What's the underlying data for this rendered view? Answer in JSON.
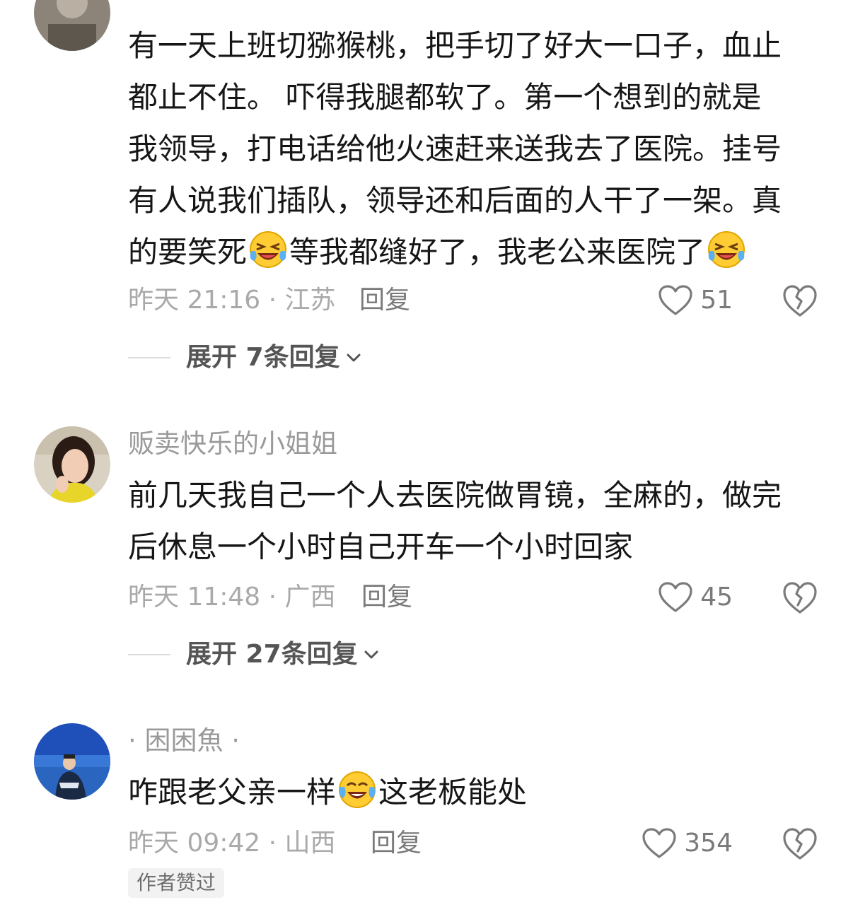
{
  "comments": [
    {
      "lines": [
        "有一天上班切猕猴桃，把手切了好大一口子，血止",
        "都止不住。 吓得我腿都软了。第一个想到的就是",
        "我领导，打电话给他火速赶来送我去了医院。挂号",
        "有人说我们插队，领导还和后面的人干了一架。真"
      ],
      "last_line_parts": [
        "的要笑死",
        "等我都缝好了，我老公来医院了",
        ""
      ],
      "emoji": "grinning-squinting-tears-emoji",
      "meta": "昨天 21:16 · 江苏",
      "reply": "回复",
      "likes": "51",
      "expand": "展开 7条回复"
    },
    {
      "username": "贩卖快乐的小姐姐",
      "lines": [
        "前几天我自己一个人去医院做胃镜，全麻的，做完",
        "后休息一个小时自己开车一个小时回家"
      ],
      "meta": "昨天 11:48 · 广西",
      "reply": "回复",
      "likes": "45",
      "expand": "展开 27条回复"
    },
    {
      "username": "· 困困魚 ·",
      "line_parts": [
        "咋跟老父亲一样",
        "这老板能处"
      ],
      "emoji": "tears-of-joy-emoji",
      "meta": "昨天 09:42 · 山西",
      "reply": "回复",
      "likes": "354",
      "badge": "作者赞过"
    }
  ],
  "colors": {
    "text": "#161616",
    "meta": "#a9a9a9",
    "username": "#9a9a9a",
    "icon": "#7a7a7a"
  }
}
